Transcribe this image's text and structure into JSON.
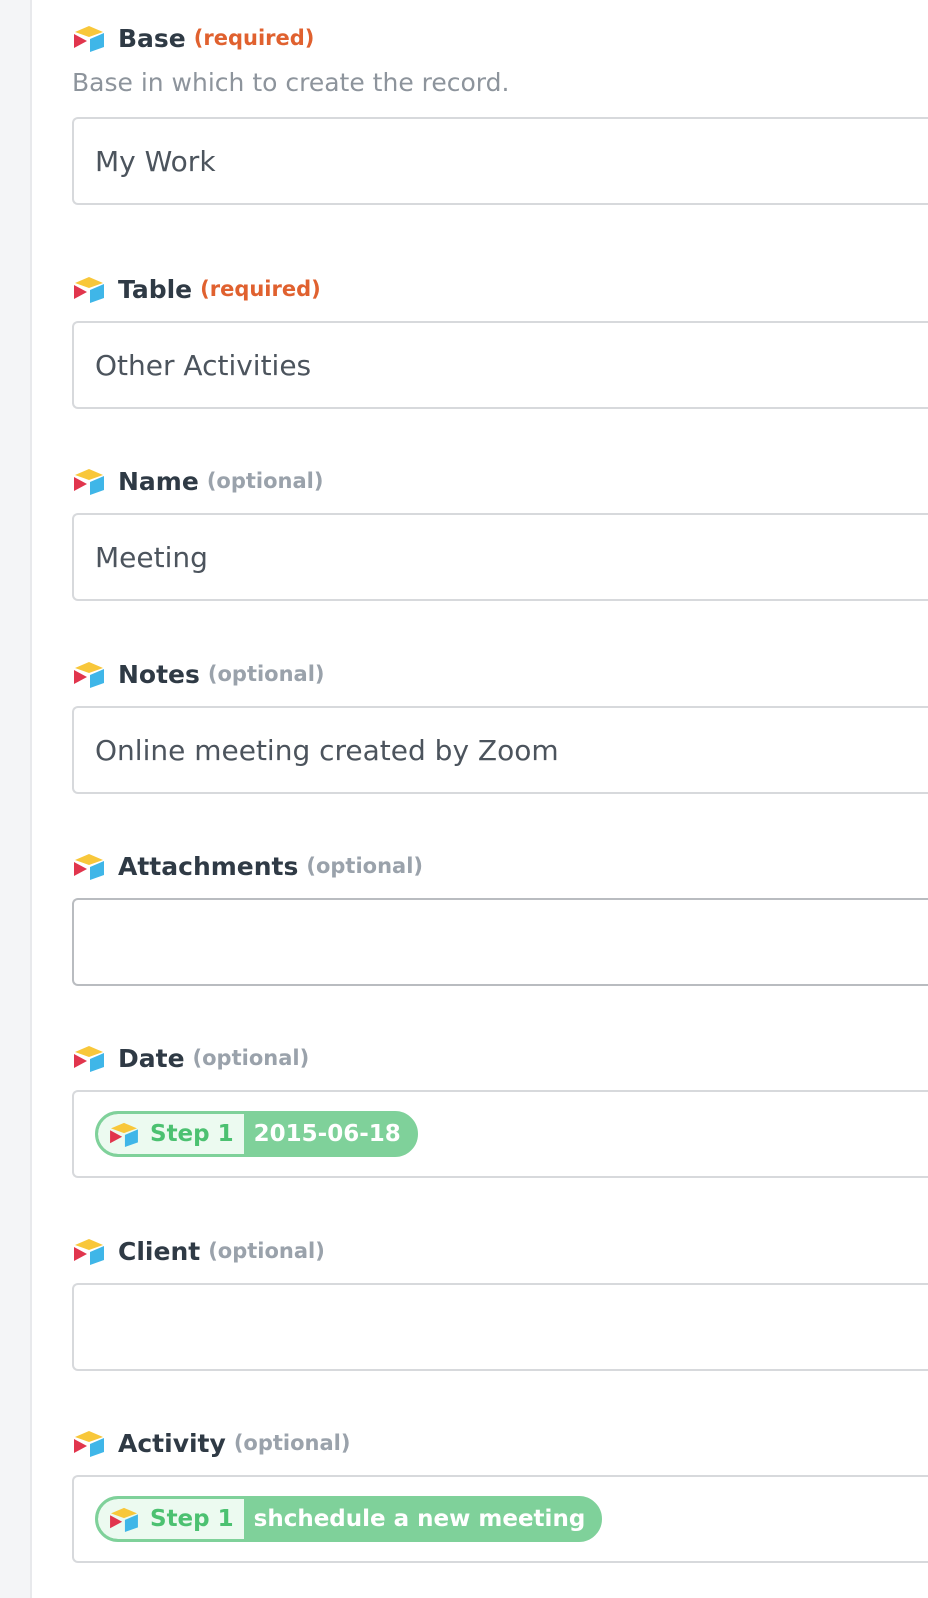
{
  "fields": [
    {
      "name": "Base",
      "tag": "(required)",
      "help": "Base in which to create the record.",
      "value": "My Work"
    },
    {
      "name": "Table",
      "tag": "(required)",
      "value": "Other Activities"
    },
    {
      "name": "Name",
      "tag": "(optional)",
      "value": "Meeting"
    },
    {
      "name": "Notes",
      "tag": "(optional)",
      "value": "Online meeting created by Zoom"
    },
    {
      "name": "Attachments",
      "tag": "(optional)",
      "value": ""
    },
    {
      "name": "Date",
      "tag": "(optional)",
      "pill": {
        "step": "Step 1",
        "value": "2015-06-18"
      }
    },
    {
      "name": "Client",
      "tag": "(optional)",
      "value": ""
    },
    {
      "name": "Activity",
      "tag": "(optional)",
      "pill": {
        "step": "Step 1",
        "value": "shchedule a new meeting"
      }
    }
  ],
  "colors": {
    "required": "#e0612f",
    "optional": "#9aa2ab",
    "pill": "#7fd19a",
    "pill_text": "#4cc171"
  },
  "icon": "airtable-app-icon"
}
